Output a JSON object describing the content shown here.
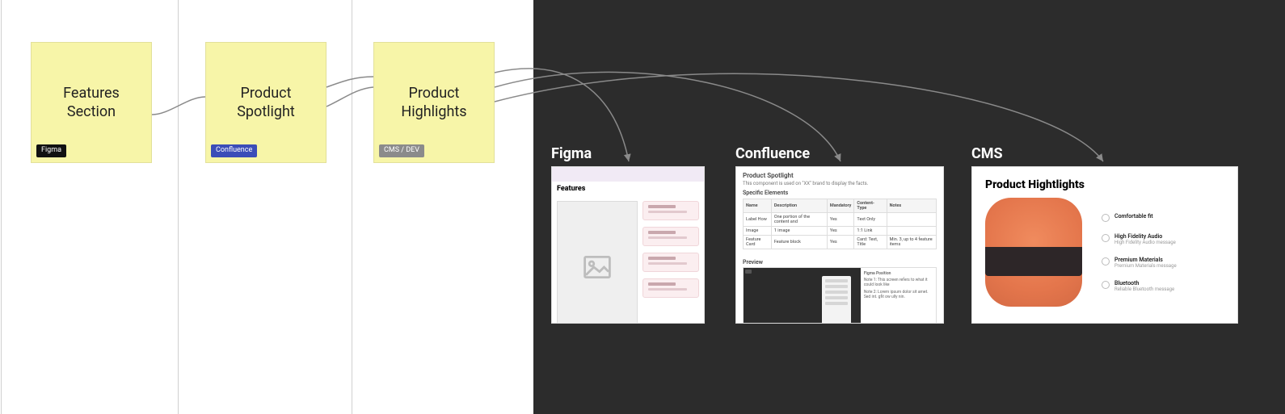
{
  "stickies": [
    {
      "label": "Features\nSection",
      "tag": "Figma",
      "tagClass": "tag-figma"
    },
    {
      "label": "Product\nSpotlight",
      "tag": "Confluence",
      "tagClass": "tag-confluence"
    },
    {
      "label": "Product\nHighlights",
      "tag": "CMS / DEV",
      "tagClass": "tag-cms"
    }
  ],
  "panels": {
    "figma": {
      "title": "Figma",
      "thumbHeading": "Features"
    },
    "confluence": {
      "title": "Confluence",
      "docTitle": "Product Spotlight",
      "docSubtitle": "This component is used on \"XX\" brand to display the facts.",
      "sectionTitle": "Specific Elements",
      "table": {
        "headers": [
          "Name",
          "Description",
          "Mandatory",
          "Content-Type",
          "Notes"
        ],
        "rows": [
          [
            "Label How",
            "One portion of the content and",
            "Yes",
            "Text Only",
            ""
          ],
          [
            "Image",
            "1 image",
            "Yes",
            "1:1 Link",
            ""
          ],
          [
            "Feature Card",
            "Feature block",
            "Yes",
            "Card: Text, Title",
            "Min. 3, up to 4 feature items"
          ]
        ]
      },
      "previewLabel": "Preview",
      "sideNote": "Figma Position",
      "sideNoteBody": "Note 1: This screen refers to what it could look like",
      "sideNoteBody2": "Note 2: Lorem ipsum dolor sit amet. Sed int. gfit ow ully nin."
    },
    "cms": {
      "title": "CMS",
      "heading": "Product Hightlights",
      "features": [
        {
          "title": "Comfortable fit",
          "sub": ""
        },
        {
          "title": "High Fidelity Audio",
          "sub": "High Fidelity Audio message"
        },
        {
          "title": "Premium Materials",
          "sub": "Premium Materials message"
        },
        {
          "title": "Bluetooth",
          "sub": "Reliable Bluetooth message"
        }
      ]
    }
  }
}
